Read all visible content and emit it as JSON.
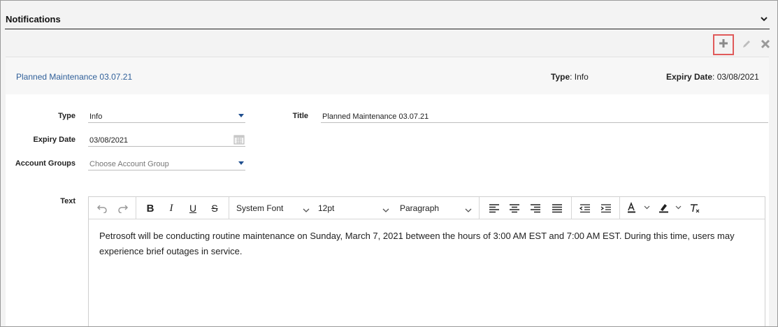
{
  "header": {
    "title": "Notifications"
  },
  "icons": {
    "collapse": "chevron-down-icon",
    "add": "plus-icon",
    "edit": "pencil-icon",
    "delete": "close-icon",
    "calendar": "calendar-icon"
  },
  "colors": {
    "link": "#2f5f99",
    "highlight_border": "#e05a5a",
    "caret": "#1f4f8f"
  },
  "card": {
    "title": "Planned Maintenance 03.07.21",
    "type_label": "Type",
    "type_value": ": Info",
    "expiry_label": "Expiry Date",
    "expiry_value": ": 03/08/2021"
  },
  "form": {
    "type_label": "Type",
    "type_value": "Info",
    "title_label": "Title",
    "title_value": "Planned Maintenance 03.07.21",
    "expiry_label": "Expiry Date",
    "expiry_value": "03/08/2021",
    "groups_label": "Account Groups",
    "groups_placeholder": "Choose Account Group",
    "text_label": "Text"
  },
  "editor": {
    "font": "System Font",
    "size": "12pt",
    "block": "Paragraph",
    "bold": "B",
    "italic": "I",
    "underline": "U",
    "strike": "S",
    "body": "Petrosoft will be conducting routine maintenance on Sunday, March 7, 2021 between the hours of 3:00 AM EST and 7:00 AM EST. During this time, users may experience brief outages in service."
  }
}
